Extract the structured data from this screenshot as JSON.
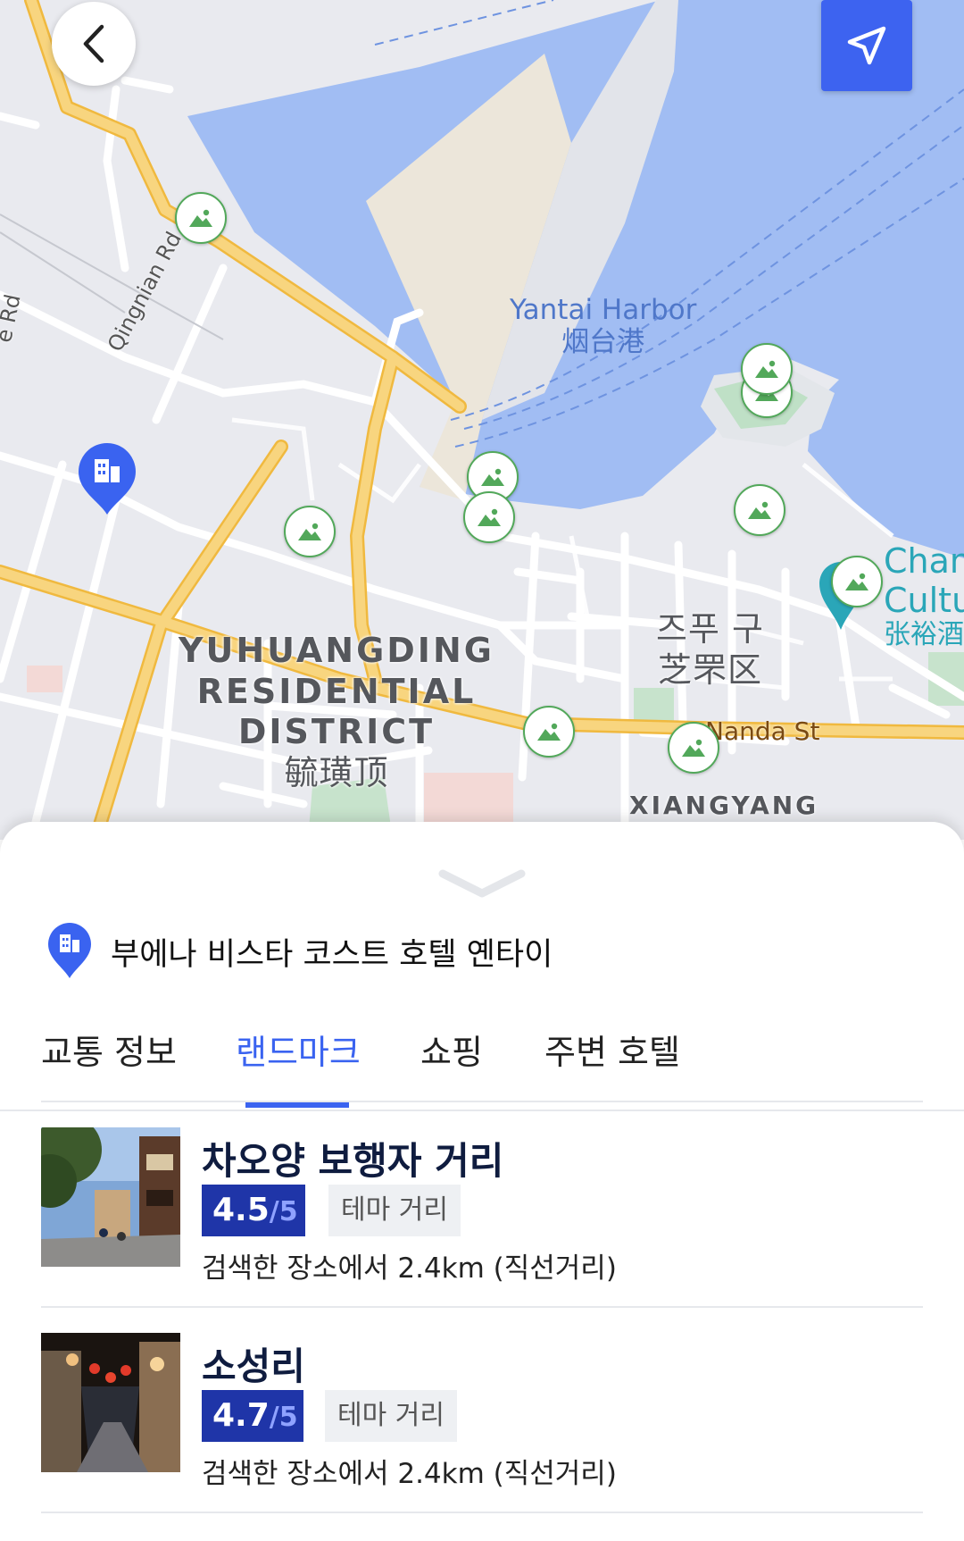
{
  "map": {
    "harbor_en": "Yantai Harbor",
    "harbor_cn": "烟台港",
    "district1_line1": "YUHUANGDING",
    "district1_line2": "RESIDENTIAL",
    "district1_line3": "DISTRICT",
    "district1_cn": "毓璜顶",
    "district2_kr": "즈푸 구",
    "district2_cn": "芝罘区",
    "district3": "XIANGYANG",
    "road_qingnian": "Qingnian Rd",
    "road_left": "e Rd",
    "road_nanda": "Nanda St",
    "poi_line1": "Chan",
    "poi_line2": "Cultu",
    "poi_cn": "张裕酒"
  },
  "icons": {
    "back": "chevron-left-icon",
    "locate": "navigation-arrow-icon",
    "landmark": "landscape-icon",
    "hotel": "building-pin-icon"
  },
  "colors": {
    "accent": "#3a63f0",
    "rating_bg": "#1f35a8",
    "water": "#a1bdf3",
    "road": "#f6cf68",
    "landmark_green": "#52a85a"
  },
  "sheet": {
    "hotel_name": "부에나 비스타 코스트 호텔 옌타이",
    "tabs": [
      "교통 정보",
      "랜드마크",
      "쇼핑",
      "주변 호텔"
    ],
    "active_tab": "랜드마크",
    "landmarks": [
      {
        "title": "차오양 보행자 거리",
        "score": "4.5",
        "outof": "/5",
        "tag": "테마 거리",
        "distance": "검색한 장소에서 2.4km (직선거리)"
      },
      {
        "title": "소성리",
        "score": "4.7",
        "outof": "/5",
        "tag": "테마 거리",
        "distance": "검색한 장소에서 2.4km (직선거리)"
      }
    ]
  }
}
